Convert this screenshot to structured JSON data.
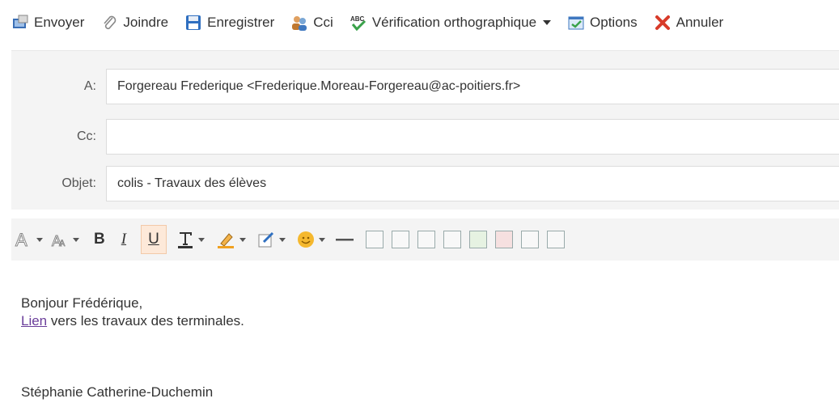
{
  "toolbar": {
    "send_label": "Envoyer",
    "attach_label": "Joindre",
    "save_label": "Enregistrer",
    "bcc_label": "Cci",
    "spellcheck_label": "Vérification orthographique",
    "options_label": "Options",
    "cancel_label": "Annuler"
  },
  "header": {
    "to_label": "A:",
    "to_value": "Forgereau Frederique <Frederique.Moreau-Forgereau@ac-poitiers.fr>",
    "cc_label": "Cc:",
    "cc_value": "",
    "subject_label": "Objet:",
    "subject_value": "colis - Travaux des élèves"
  },
  "format_toolbar": {
    "bold": "B",
    "italic": "I",
    "underline": "U"
  },
  "message": {
    "greeting": "Bonjour Frédérique,",
    "link_text": "Lien",
    "line_rest": " vers les travaux des terminales.",
    "signature": "Stéphanie Catherine-Duchemin"
  },
  "colors": {
    "link": "#6a3d9a",
    "header_bg": "#f4f4f4",
    "cancel_red": "#d83b2a"
  }
}
